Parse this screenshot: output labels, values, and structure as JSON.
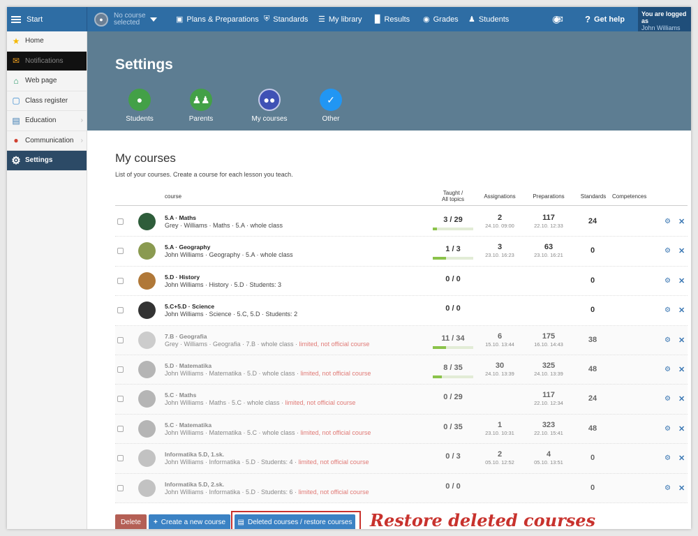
{
  "topbar": {
    "start": "Start",
    "course_line1": "No course",
    "course_line2": "selected",
    "plans": "Plans & Preparations",
    "standards": "Standards",
    "library": "My library",
    "results": "Results",
    "grades": "Grades",
    "students": "Students",
    "help": "Get help",
    "logged_label": "You are logged as",
    "logged_user": "John Williams"
  },
  "sidebar": {
    "items": [
      {
        "label": "Home"
      },
      {
        "label": "Notifications"
      },
      {
        "label": "Web page"
      },
      {
        "label": "Class register"
      },
      {
        "label": "Education"
      },
      {
        "label": "Communication"
      },
      {
        "label": "Settings"
      }
    ]
  },
  "header": {
    "title": "Settings",
    "nav": [
      {
        "label": "Students",
        "color": "#43a047"
      },
      {
        "label": "Parents",
        "color": "#43a047"
      },
      {
        "label": "My courses",
        "color": "#3f51b5"
      },
      {
        "label": "Other",
        "color": "#2196f3"
      }
    ]
  },
  "main": {
    "title": "My courses",
    "subtitle": "List of your courses. Create a course for each lesson you teach.",
    "columns": {
      "course": "course",
      "taught_1": "Taught /",
      "taught_2": "All topics",
      "assignments": "Assignations",
      "preparations": "Preparations",
      "standards": "Standards",
      "competences": "Competences"
    },
    "rows": [
      {
        "name": "5.A · Maths",
        "meta": "Grey · Williams · Maths · 5.A · whole class",
        "limited": "",
        "taught": "3 / 29",
        "progress": 0.1,
        "assign": "2",
        "assign_date": "24.10. 09:00",
        "prep": "117",
        "prep_date": "22.10. 12:33",
        "standards": "24",
        "muted": false,
        "avatar": "#2e5d3a"
      },
      {
        "name": "5.A · Geography",
        "meta": "John Williams · Geography · 5.A · whole class",
        "limited": "",
        "taught": "1 / 3",
        "progress": 0.33,
        "assign": "3",
        "assign_date": "23.10. 16:23",
        "prep": "63",
        "prep_date": "23.10. 16:21",
        "standards": "0",
        "muted": false,
        "avatar": "#8a9a50"
      },
      {
        "name": "5.D · History",
        "meta": "John Williams · History · 5.D · Students: 3",
        "limited": "",
        "taught": "0 / 0",
        "progress": 0,
        "assign": "",
        "assign_date": "",
        "prep": "",
        "prep_date": "",
        "standards": "0",
        "muted": false,
        "avatar": "#b07838"
      },
      {
        "name": "5.C+5.D · Science",
        "meta": "John Williams · Science · 5.C, 5.D · Students: 2",
        "limited": "",
        "taught": "0 / 0",
        "progress": 0,
        "assign": "",
        "assign_date": "",
        "prep": "",
        "prep_date": "",
        "standards": "0",
        "muted": false,
        "avatar": "#333333"
      },
      {
        "name": "7.B · Geografia",
        "meta": "Grey · Williams · Geografia · 7.B · whole class · ",
        "limited": "limited, not official course",
        "taught": "11 / 34",
        "progress": 0.32,
        "assign": "6",
        "assign_date": "15.10. 13:44",
        "prep": "175",
        "prep_date": "16.10. 14:43",
        "standards": "38",
        "muted": true,
        "avatar": "#cccccc"
      },
      {
        "name": "5.D · Matematika",
        "meta": "John Williams · Matematika · 5.D · whole class · ",
        "limited": "limited, not official course",
        "taught": "8 / 35",
        "progress": 0.23,
        "assign": "30",
        "assign_date": "24.10. 13:39",
        "prep": "325",
        "prep_date": "24.10. 13:39",
        "standards": "48",
        "muted": true,
        "avatar": "#b5b5b5"
      },
      {
        "name": "5.C · Maths",
        "meta": "John Williams · Maths · 5.C · whole class · ",
        "limited": "limited, not official course",
        "taught": "0 / 29",
        "progress": 0,
        "assign": "",
        "assign_date": "",
        "prep": "117",
        "prep_date": "22.10. 12:34",
        "standards": "24",
        "muted": true,
        "avatar": "#b5b5b5"
      },
      {
        "name": "5.C · Matematika",
        "meta": "John Williams · Matematika · 5.C · whole class · ",
        "limited": "limited, not official course",
        "taught": "0 / 35",
        "progress": 0,
        "assign": "1",
        "assign_date": "23.10. 10:31",
        "prep": "323",
        "prep_date": "22.10. 15:41",
        "standards": "48",
        "muted": true,
        "avatar": "#b5b5b5"
      },
      {
        "name": "Informatika 5.D, 1.sk.",
        "meta": "John Williams · Informatika · 5.D · Students: 4 · ",
        "limited": "limited, not official course",
        "taught": "0 / 3",
        "progress": 0,
        "assign": "2",
        "assign_date": "05.10. 12:52",
        "prep": "4",
        "prep_date": "05.10. 13:51",
        "standards": "0",
        "muted": true,
        "avatar": "#c2c2c2"
      },
      {
        "name": "Informatika 5.D, 2.sk.",
        "meta": "John Williams · Informatika · 5.D · Students: 6 · ",
        "limited": "limited, not official course",
        "taught": "0 / 0",
        "progress": 0,
        "assign": "",
        "assign_date": "",
        "prep": "",
        "prep_date": "",
        "standards": "0",
        "muted": true,
        "avatar": "#c2c2c2"
      }
    ],
    "buttons": {
      "delete": "Delete",
      "create": "Create a new course",
      "restore": "Deleted courses / restore courses"
    },
    "annotation": "Restore deleted courses"
  }
}
